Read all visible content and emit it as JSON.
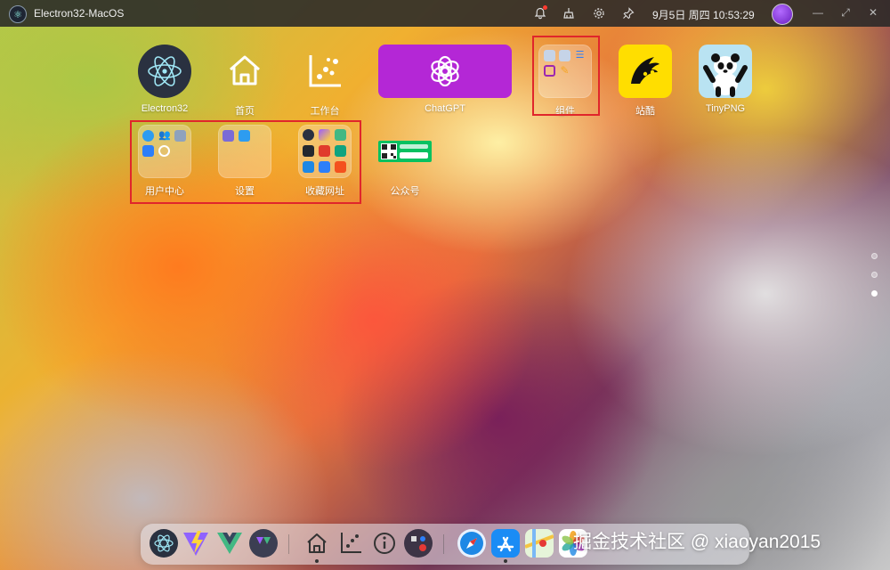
{
  "titlebar": {
    "app_title": "Electron32-MacOS",
    "clock": "9月5日 周四 10:53:29",
    "icons": [
      "bell-icon",
      "broom-icon",
      "gear-icon",
      "pin-icon"
    ],
    "controls": [
      "minimize-icon",
      "maximize-icon",
      "close-icon"
    ]
  },
  "desktop": {
    "row1": {
      "electron": "Electron32",
      "home": "首页",
      "workbench": "工作台",
      "chatgpt": "ChatGPT",
      "widgets": "组件",
      "zcool": "站酷",
      "tinypng": "TinyPNG"
    },
    "row2": {
      "user_center": "用户中心",
      "settings": "设置",
      "favorites": "收藏网址",
      "official": "公众号"
    }
  },
  "colors": {
    "chatgpt_bg": "#b427d6",
    "zcool_bg": "#ffde00",
    "highlight_frame": "#e0262b",
    "wechat_green": "#07c160"
  },
  "dock": {
    "items": [
      "electron-icon",
      "vite-icon",
      "vue-icon",
      "vite-vue-icon",
      "home-icon",
      "chart-icon",
      "info-icon",
      "mixed-icon",
      "safari-icon",
      "appstore-icon",
      "maps-icon",
      "photos-icon"
    ]
  },
  "watermark": "掘金技术社区 @ xiaoyan2015"
}
